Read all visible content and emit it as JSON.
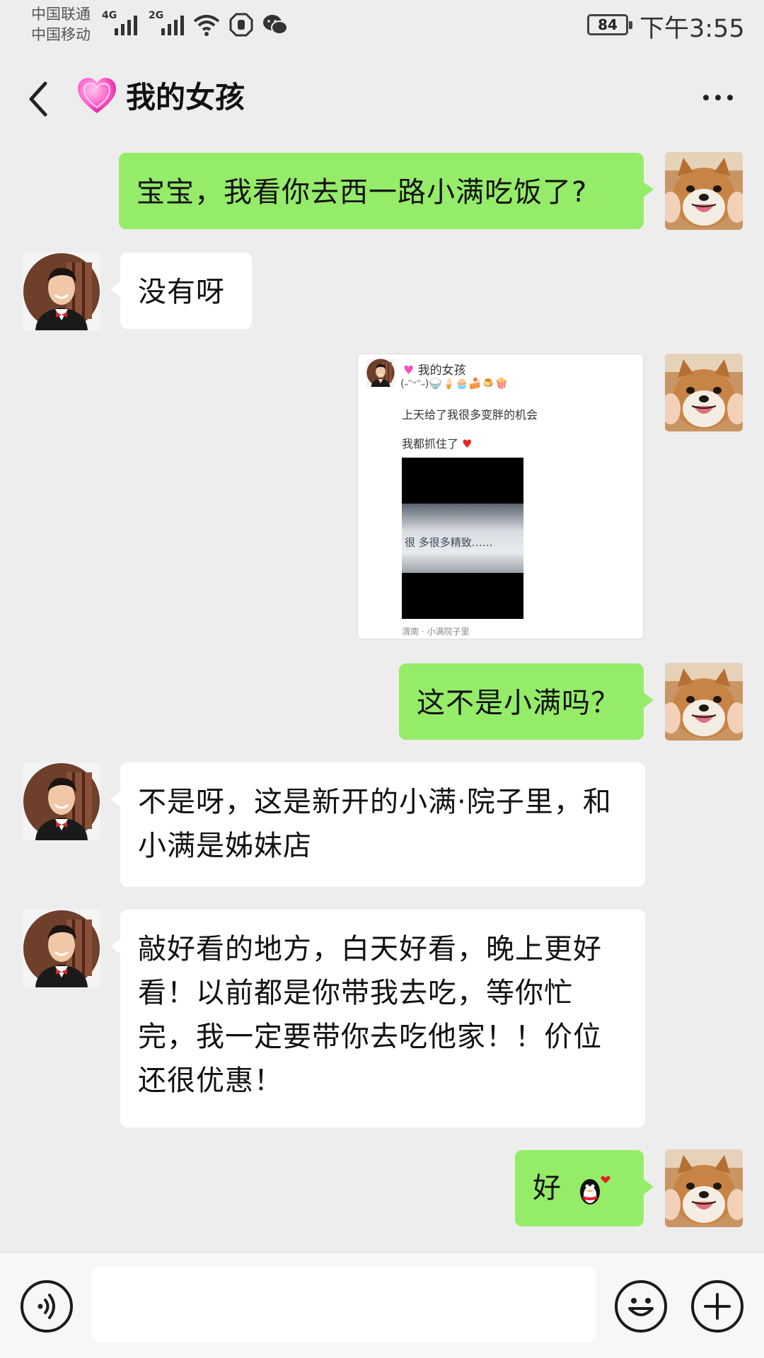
{
  "status_bar": {
    "carrier_1": "中国联通",
    "carrier_2": "中国移动",
    "network_1": "4G",
    "network_2": "2G",
    "icons": [
      "signal-icon",
      "signal-icon",
      "wifi-icon",
      "notification-icon",
      "wechat-icon"
    ],
    "battery": "84",
    "time": "下午3:55"
  },
  "header": {
    "back_icon": "chevron-left-icon",
    "title_icon": "pink-heart-icon",
    "title": "我的女孩",
    "more_icon": "more-dots-icon"
  },
  "messages": [
    {
      "sender": "me",
      "text": "宝宝，我看你去西一路小满吃饭了?"
    },
    {
      "sender": "other",
      "text": "没有呀"
    },
    {
      "sender": "me",
      "type": "image",
      "card": {
        "name": "我的女孩",
        "line1": "上天给了我很多变胖的机会",
        "line2": "我都抓住了",
        "video_caption": "很 多很多精致……",
        "location": "渭南 · 小满院子里"
      }
    },
    {
      "sender": "me",
      "text": "这不是小满吗？"
    },
    {
      "sender": "other",
      "text": "不是呀，这是新开的小满·院子里，和小满是姊妹店"
    },
    {
      "sender": "other",
      "text": "敲好看的地方，白天好看，晚上更好看！以前都是你带我去吃，等你忙完，我一定要带你去吃他家！！价位还很优惠！"
    },
    {
      "sender": "me",
      "text": "好",
      "emoji": "qq-penguin-heart-icon"
    }
  ],
  "input_bar": {
    "voice_icon": "voice-icon",
    "emoji_icon": "smiley-icon",
    "plus_icon": "plus-icon",
    "input_value": ""
  },
  "colors": {
    "background": "#ededed",
    "my_bubble": "#95ec69",
    "their_bubble": "#ffffff"
  }
}
